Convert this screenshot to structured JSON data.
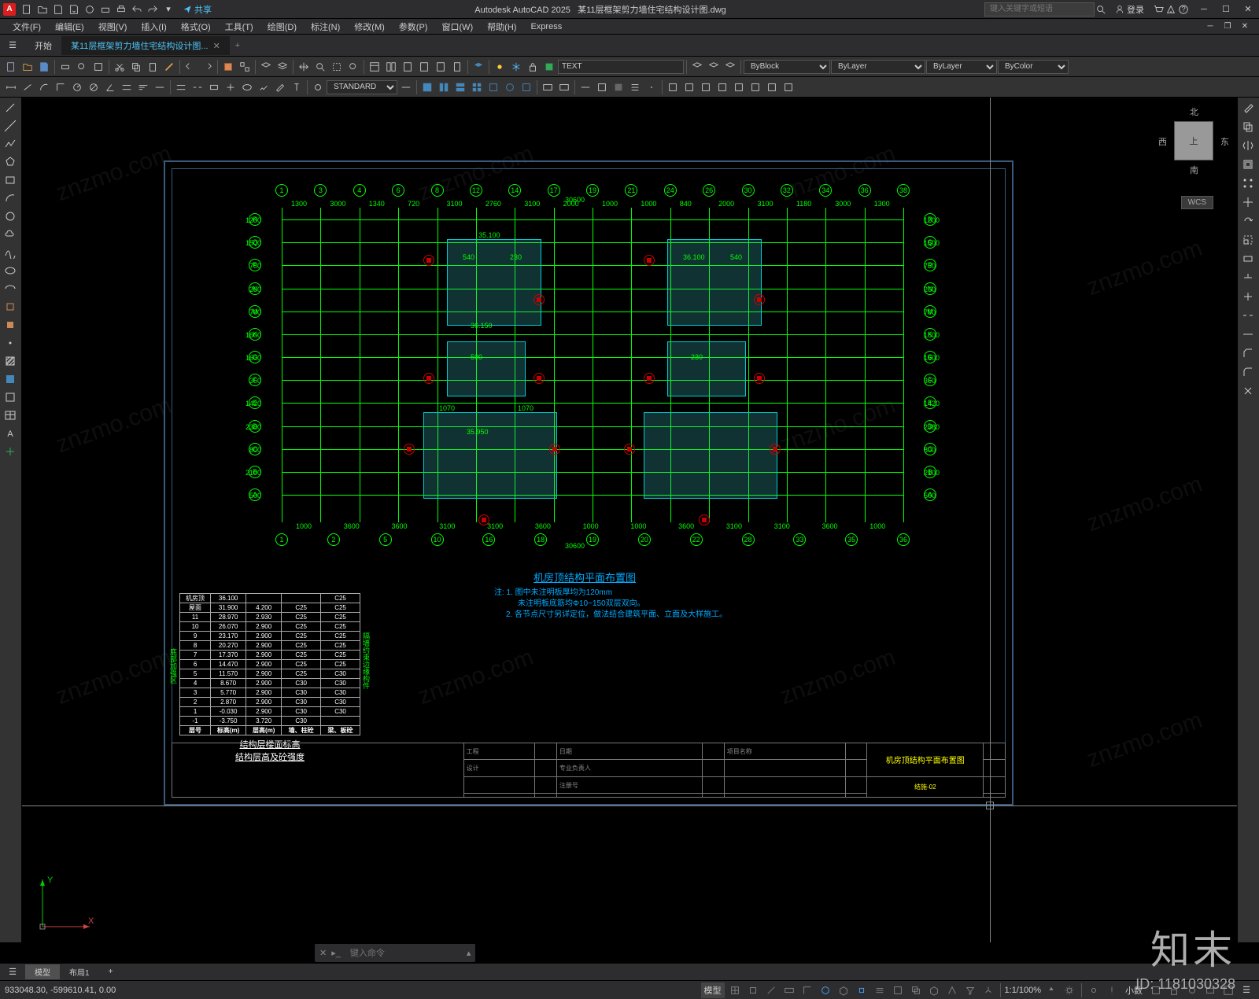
{
  "app": {
    "name": "Autodesk AutoCAD 2025",
    "file": "某11层框架剪力墙住宅结构设计图.dwg",
    "icon": "A"
  },
  "qat": {
    "share": "共享"
  },
  "search": {
    "placeholder": "键入关键字或短语"
  },
  "login": {
    "label": "登录"
  },
  "menu": {
    "file": "文件(F)",
    "edit": "编辑(E)",
    "view": "视图(V)",
    "insert": "插入(I)",
    "format": "格式(O)",
    "tools": "工具(T)",
    "draw": "绘图(D)",
    "dimension": "标注(N)",
    "modify": "修改(M)",
    "param": "参数(P)",
    "window": "窗口(W)",
    "help": "帮助(H)",
    "express": "Express"
  },
  "tabs": {
    "start": "开始",
    "doc": "某11层框架剪力墙住宅结构设计图..."
  },
  "toolbar": {
    "textstyle": "STANDARD",
    "dimstyle": "TEXT",
    "layer_color": "ByBlock",
    "lineweight": "ByLayer",
    "linetype": "ByLayer",
    "plotstyle": "ByColor"
  },
  "viewcube": {
    "n": "北",
    "s": "南",
    "e": "东",
    "w": "西",
    "top": "上",
    "wcs": "WCS"
  },
  "ucs": {
    "x": "X",
    "y": "Y"
  },
  "drawing": {
    "grid_cols": [
      "1",
      "3",
      "4",
      "6",
      "8",
      "12",
      "14",
      "17",
      "19",
      "21",
      "24",
      "26",
      "30",
      "32",
      "34",
      "36",
      "38"
    ],
    "grid_col_bot": [
      "1",
      "2",
      "5",
      "10",
      "16",
      "18",
      "19",
      "20",
      "22",
      "28",
      "33",
      "35",
      "36"
    ],
    "grid_rows": [
      "R",
      "Q",
      "P",
      "N",
      "M",
      "K",
      "G",
      "F",
      "E",
      "D",
      "C",
      "B",
      "A"
    ],
    "dims_top": [
      "1300",
      "3000",
      "1340",
      "720",
      "3100",
      "2760",
      "3100",
      "2000",
      "1000",
      "1000",
      "840",
      "2000",
      "3100",
      "1180",
      "3000",
      "1300"
    ],
    "dims_bot": [
      "1000",
      "3600",
      "3600",
      "3100",
      "3100",
      "3600",
      "1000",
      "1000",
      "3600",
      "3100",
      "3100",
      "3600",
      "1000"
    ],
    "overall_top": "30600",
    "overall_bot": "30600",
    "rows_dims": [
      "1200",
      "1500",
      "750",
      "260",
      "700",
      "1600",
      "1600",
      "360",
      "1420",
      "2380",
      "800",
      "2100",
      "500"
    ],
    "inner": [
      "540",
      "230",
      "500",
      "1070",
      "1070",
      "36.150",
      "35.950",
      "35.100",
      "36.100",
      "540",
      "230"
    ],
    "title": "机房顶结构平面布置图",
    "note1": "注: 1. 图中未注明板厚均为120mm",
    "note2": "未注明板底筋均Φ10~150双层双向。",
    "note3": "2. 各节点尺寸另详定位，做法结合建筑平面、立面及大样施工。"
  },
  "table": {
    "header": [
      "层号",
      "标高(m)",
      "层高(m)",
      "墙、柱砼",
      "梁、板砼"
    ],
    "rows": [
      [
        "机房顶",
        "36.100",
        "",
        "",
        "C25"
      ],
      [
        "屋面",
        "31.900",
        "4.200",
        "C25",
        "C25"
      ],
      [
        "11",
        "28.970",
        "2.930",
        "C25",
        "C25"
      ],
      [
        "10",
        "26.070",
        "2.900",
        "C25",
        "C25"
      ],
      [
        "9",
        "23.170",
        "2.900",
        "C25",
        "C25"
      ],
      [
        "8",
        "20.270",
        "2.900",
        "C25",
        "C25"
      ],
      [
        "7",
        "17.370",
        "2.900",
        "C25",
        "C25"
      ],
      [
        "6",
        "14.470",
        "2.900",
        "C25",
        "C25"
      ],
      [
        "5",
        "11.570",
        "2.900",
        "C25",
        "C30"
      ],
      [
        "4",
        "8.670",
        "2.900",
        "C30",
        "C30"
      ],
      [
        "3",
        "5.770",
        "2.900",
        "C30",
        "C30"
      ],
      [
        "2",
        "2.870",
        "2.900",
        "C30",
        "C30"
      ],
      [
        "1",
        "-0.030",
        "2.900",
        "C30",
        "C30"
      ],
      [
        "-1",
        "-3.750",
        "3.720",
        "C30",
        ""
      ]
    ],
    "side_l": "底部加强区",
    "side_r": "隔墙约束边缘构件",
    "caption1": "结构层楼面标高",
    "caption2": "结构层高及砼强度"
  },
  "titleblock": {
    "cells": [
      "工程",
      "日期",
      "项目名称",
      "设计",
      "专业负责人",
      "注册号",
      "机房顶结构平面布置图",
      "结施-02"
    ]
  },
  "cmd": {
    "placeholder": "键入命令"
  },
  "layout": {
    "model": "模型",
    "layout1": "布局1"
  },
  "status": {
    "coords": "933048.30, -599610.41, 0.00",
    "scale": "1:1/100%",
    "units": "小数",
    "angle": "▾"
  },
  "brand": {
    "name": "知末",
    "id": "ID: 1181030328"
  },
  "wm": "znzmo.com"
}
